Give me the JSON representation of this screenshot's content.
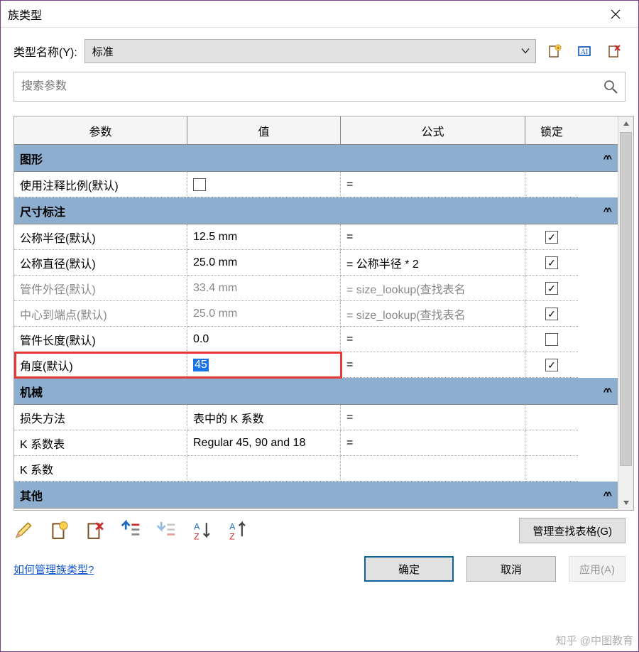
{
  "title": "族类型",
  "typeName": {
    "label": "类型名称(Y):",
    "selected": "标准"
  },
  "search": {
    "placeholder": "搜索参数"
  },
  "columns": {
    "param": "参数",
    "value": "值",
    "formula": "公式",
    "lock": "锁定"
  },
  "groups": [
    {
      "name": "图形",
      "rows": [
        {
          "param": "使用注释比例(默认)",
          "value_checkbox": false,
          "formula": "=",
          "lock": null,
          "grey": false
        }
      ]
    },
    {
      "name": "尺寸标注",
      "rows": [
        {
          "param": "公称半径(默认)",
          "value": "12.5 mm",
          "formula": "=",
          "lock": true,
          "grey": false
        },
        {
          "param": "公称直径(默认)",
          "value": "25.0 mm",
          "formula": "= 公称半径 * 2",
          "lock": true,
          "grey": false
        },
        {
          "param": "管件外径(默认)",
          "value": "33.4 mm",
          "formula": "= size_lookup(查找表名",
          "lock": true,
          "grey": true
        },
        {
          "param": "中心到端点(默认)",
          "value": "25.0 mm",
          "formula": "= size_lookup(查找表名",
          "lock": true,
          "grey": true
        },
        {
          "param": "管件长度(默认)",
          "value": "0.0",
          "formula": "=",
          "lock": false,
          "grey": false
        },
        {
          "param": "角度(默认)",
          "value": "45",
          "formula": "=",
          "lock": true,
          "grey": false,
          "highlight": true,
          "selected": true
        }
      ]
    },
    {
      "name": "机械",
      "rows": [
        {
          "param": "损失方法",
          "value": "表中的 K 系数",
          "formula": "=",
          "lock": null,
          "grey": false
        },
        {
          "param": "K 系数表",
          "value": "Regular 45, 90 and 18",
          "formula": "=",
          "lock": null,
          "grey": false
        },
        {
          "param": "K 系数",
          "value": "",
          "formula": "",
          "lock": null,
          "grey": false
        }
      ]
    },
    {
      "name": "其他",
      "rows": []
    }
  ],
  "lookupButton": "管理查找表格(G)",
  "helpLink": "如何管理族类型?",
  "buttons": {
    "ok": "确定",
    "cancel": "取消",
    "apply": "应用(A)"
  },
  "watermark": "知乎 @中图教育"
}
